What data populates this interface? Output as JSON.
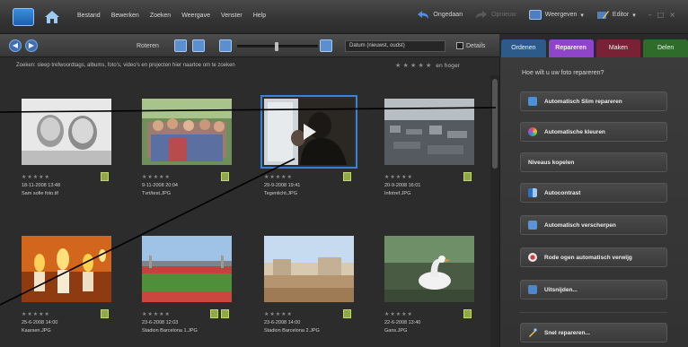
{
  "menubar": {
    "items": [
      "Bestand",
      "Bewerken",
      "Zoeken",
      "Weergave",
      "Venster",
      "Help"
    ],
    "ongedaan": "Ongedaan",
    "opnieuw": "Opnieuw",
    "weergeven": "Weergeven",
    "editor": "Editor",
    "window_controls": [
      "–",
      "□",
      "×"
    ]
  },
  "toolbar": {
    "back_icon": "arrow-left-icon",
    "forward_icon": "arrow-right-icon",
    "zoom_label": "Roteren",
    "sort_value": "Datum (nieuwst, oudst)",
    "details_label": "Details"
  },
  "tabs": [
    "Ordenen",
    "Repareren",
    "Maken",
    "Delen"
  ],
  "grid": {
    "search_hint": "Zoeken: sleep trefwoordtags, albums, foto's, video's en projecten hier naartoe om te zoeken",
    "rating_filter_label": "en hoger",
    "items": [
      {
        "date": "18-11-2008 13:48",
        "file": "Sam sofie foto.tif"
      },
      {
        "date": "9-11-2008 20:04",
        "file": "Tvrt/test.JPG"
      },
      {
        "date": "29-9-2008 19:41",
        "file": "Tegenlicht.JPG"
      },
      {
        "date": "20-9-2008 16:01",
        "file": "Infotref.JPG"
      },
      {
        "date": "25-6-2008 14:00",
        "file": "Kaarsen.JPG"
      },
      {
        "date": "23-6-2008 12:03",
        "file": "Stadion Barcelona 1.JPG"
      },
      {
        "date": "23-6-2008 14:00",
        "file": "Stadion Barcelona 2.JPG"
      },
      {
        "date": "22-6-2008 13:40",
        "file": "Gans.JPG"
      }
    ]
  },
  "panel": {
    "title": "Hoe wilt u uw foto repareren?",
    "buttons": [
      "Automatisch Slim repareren",
      "Automatische kleuren",
      "Niveaus kopelen",
      "Autocontrast",
      "Automatisch verscherpen",
      "Rode ogen automatisch verwijg",
      "Uitsnijden...",
      "Snel repareren..."
    ]
  },
  "colors": {
    "fix_tab": "#8e45c9",
    "organize_tab": "#2c5b8a",
    "create_tab": "#7b2135",
    "share_tab": "#2f6b2a",
    "selection": "#3c7fd3"
  }
}
